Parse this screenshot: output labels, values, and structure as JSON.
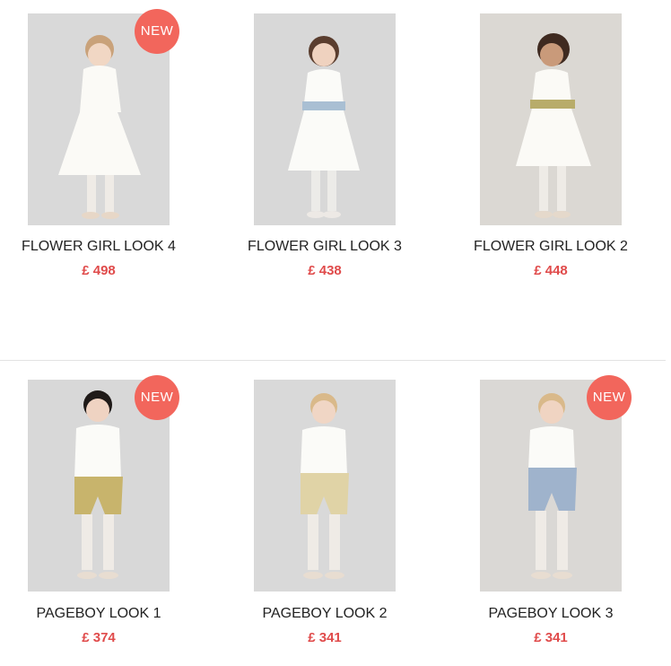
{
  "badge_label": "NEW",
  "colors": {
    "badge": "#f2665c",
    "price": "#e04b4b"
  },
  "products": [
    {
      "title": "FLOWER GIRL LOOK 4",
      "price": "£ 498",
      "new": true,
      "image": "flower-girl-white-dress"
    },
    {
      "title": "FLOWER GIRL LOOK 3",
      "price": "£ 438",
      "new": false,
      "image": "flower-girl-blue-sash-dress"
    },
    {
      "title": "FLOWER GIRL LOOK 2",
      "price": "£ 448",
      "new": false,
      "image": "flower-girl-gold-sash-dress"
    },
    {
      "title": "PAGEBOY LOOK 1",
      "price": "£ 374",
      "new": true,
      "image": "pageboy-gold-breeches"
    },
    {
      "title": "PAGEBOY LOOK 2",
      "price": "£ 341",
      "new": false,
      "image": "pageboy-champagne-breeches"
    },
    {
      "title": "PAGEBOY LOOK 3",
      "price": "£ 341",
      "new": true,
      "image": "pageboy-blue-breeches"
    }
  ]
}
